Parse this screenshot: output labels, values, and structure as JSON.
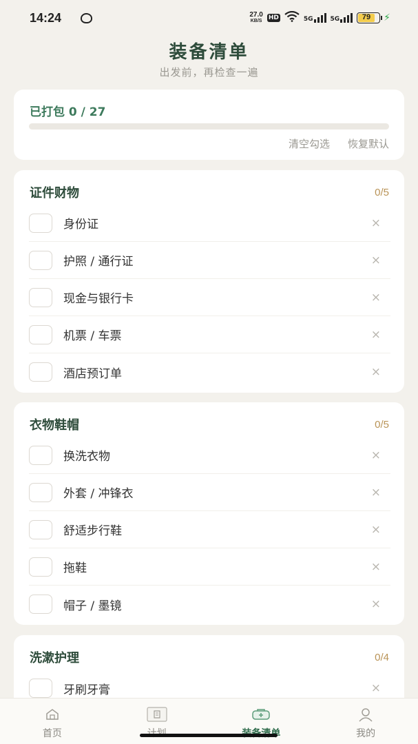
{
  "status_bar": {
    "time": "14:24",
    "net_speed_value": "27.0",
    "net_speed_unit": "KB/S",
    "hd_badge": "HD",
    "signal_1": "5G",
    "signal_2": "5G",
    "battery": "79"
  },
  "header": {
    "title": "装备清单",
    "subtitle": "出发前，再检查一遍"
  },
  "progress": {
    "label": "已打包 0 / 27",
    "packed": 0,
    "total": 27,
    "clear_label": "清空勾选",
    "reset_label": "恢复默认"
  },
  "categories": [
    {
      "title": "证件财物",
      "count": "0/5",
      "items": [
        {
          "label": "身份证",
          "checked": false
        },
        {
          "label": "护照 / 通行证",
          "checked": false
        },
        {
          "label": "现金与银行卡",
          "checked": false
        },
        {
          "label": "机票 / 车票",
          "checked": false
        },
        {
          "label": "酒店预订单",
          "checked": false
        }
      ]
    },
    {
      "title": "衣物鞋帽",
      "count": "0/5",
      "items": [
        {
          "label": "换洗衣物",
          "checked": false
        },
        {
          "label": "外套 / 冲锋衣",
          "checked": false
        },
        {
          "label": "舒适步行鞋",
          "checked": false
        },
        {
          "label": "拖鞋",
          "checked": false
        },
        {
          "label": "帽子 / 墨镜",
          "checked": false
        }
      ]
    },
    {
      "title": "洗漱护理",
      "count": "0/4",
      "items": [
        {
          "label": "牙刷牙膏",
          "checked": false
        }
      ]
    }
  ],
  "delete_glyph": "×",
  "nav": [
    {
      "label": "首页",
      "icon": "home-icon",
      "active": false
    },
    {
      "label": "计划",
      "icon": "plan-icon",
      "active": false
    },
    {
      "label": "装备清单",
      "icon": "checklist-icon",
      "active": true
    },
    {
      "label": "我的",
      "icon": "profile-icon",
      "active": false
    }
  ],
  "colors": {
    "accent": "#3d7a5c",
    "title": "#2e4c3b",
    "count": "#b99356",
    "background": "#f3f1ec"
  }
}
